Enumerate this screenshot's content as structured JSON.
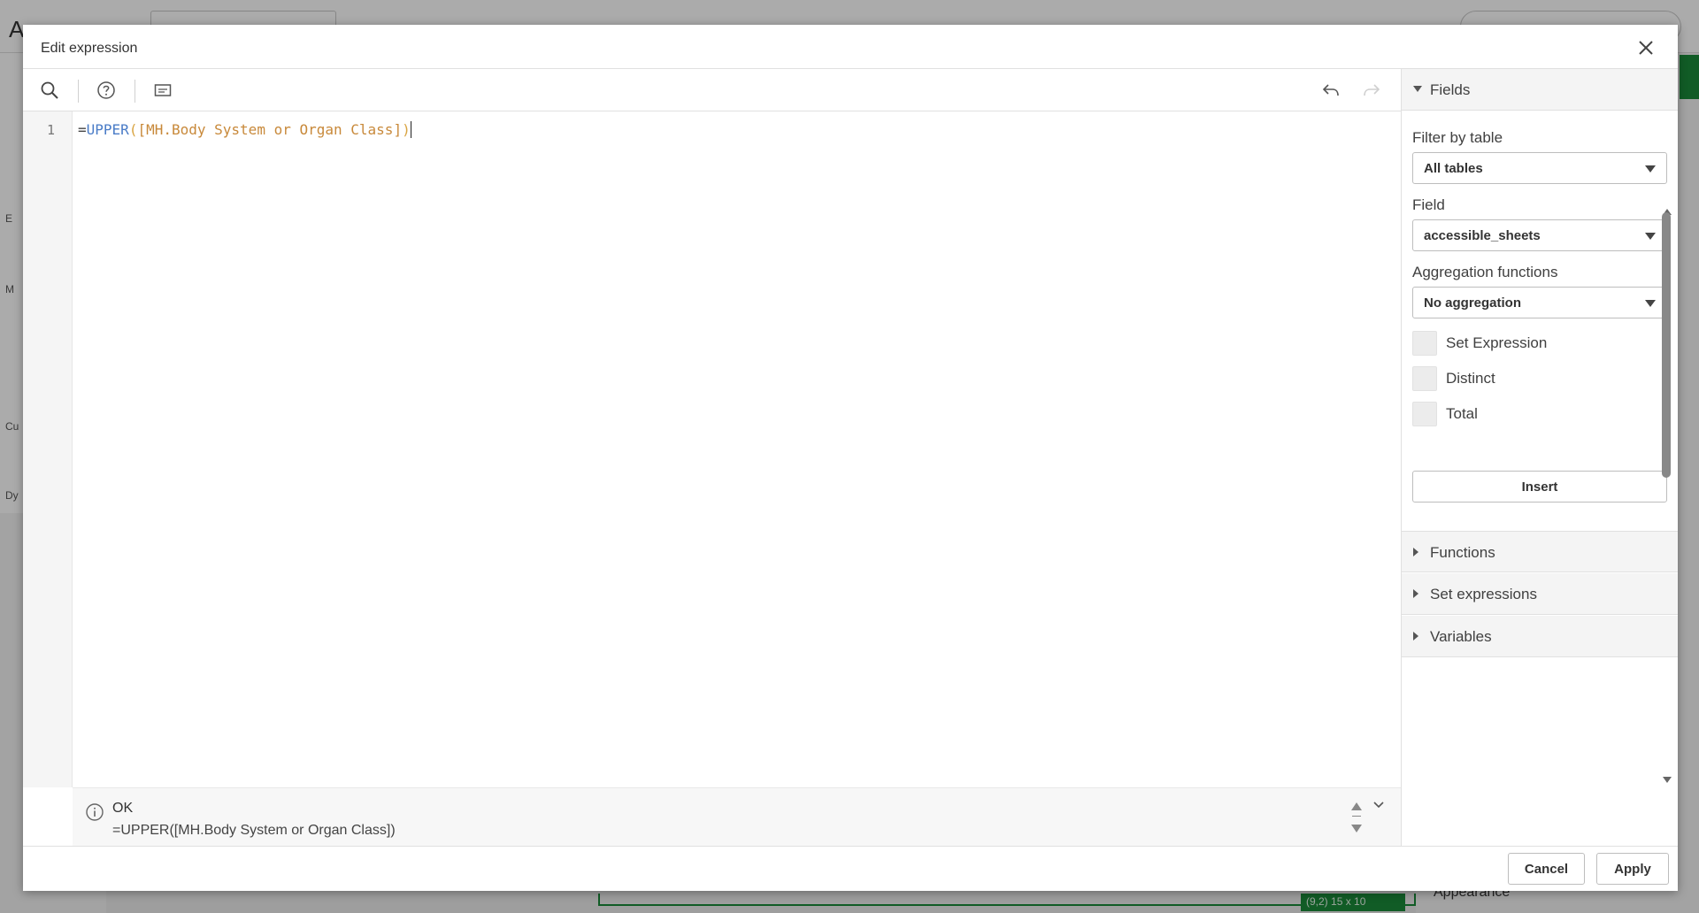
{
  "background": {
    "app_title": "A",
    "appearance_label": "Appearance",
    "selection_coords": "(9,2)",
    "selection_size": "15 x 10",
    "left_labels": [
      "E",
      "M",
      "Cu",
      "Dy"
    ]
  },
  "dialog": {
    "title": "Edit expression",
    "editor": {
      "line_number": "1",
      "code": {
        "equals": "=",
        "function": "UPPER",
        "open": "(",
        "field": "[MH.Body System or Organ Class]",
        "close": ")"
      }
    },
    "status": {
      "state": "OK",
      "expression": "=UPPER([MH.Body System or Organ Class])"
    },
    "panel": {
      "fields_header": "Fields",
      "filter_by_table_label": "Filter by table",
      "filter_by_table_value": "All tables",
      "field_label": "Field",
      "field_value": "accessible_sheets",
      "aggregation_label": "Aggregation functions",
      "aggregation_value": "No aggregation",
      "checkboxes": {
        "set_expression": "Set Expression",
        "distinct": "Distinct",
        "total": "Total"
      },
      "insert_label": "Insert",
      "functions_header": "Functions",
      "set_expressions_header": "Set expressions",
      "variables_header": "Variables"
    },
    "footer": {
      "cancel_label": "Cancel",
      "apply_label": "Apply"
    }
  },
  "colors": {
    "function": "#4a7cc7",
    "field": "#c8893a",
    "bracket": "#d9a441",
    "accent_green": "#1a8a3a"
  }
}
